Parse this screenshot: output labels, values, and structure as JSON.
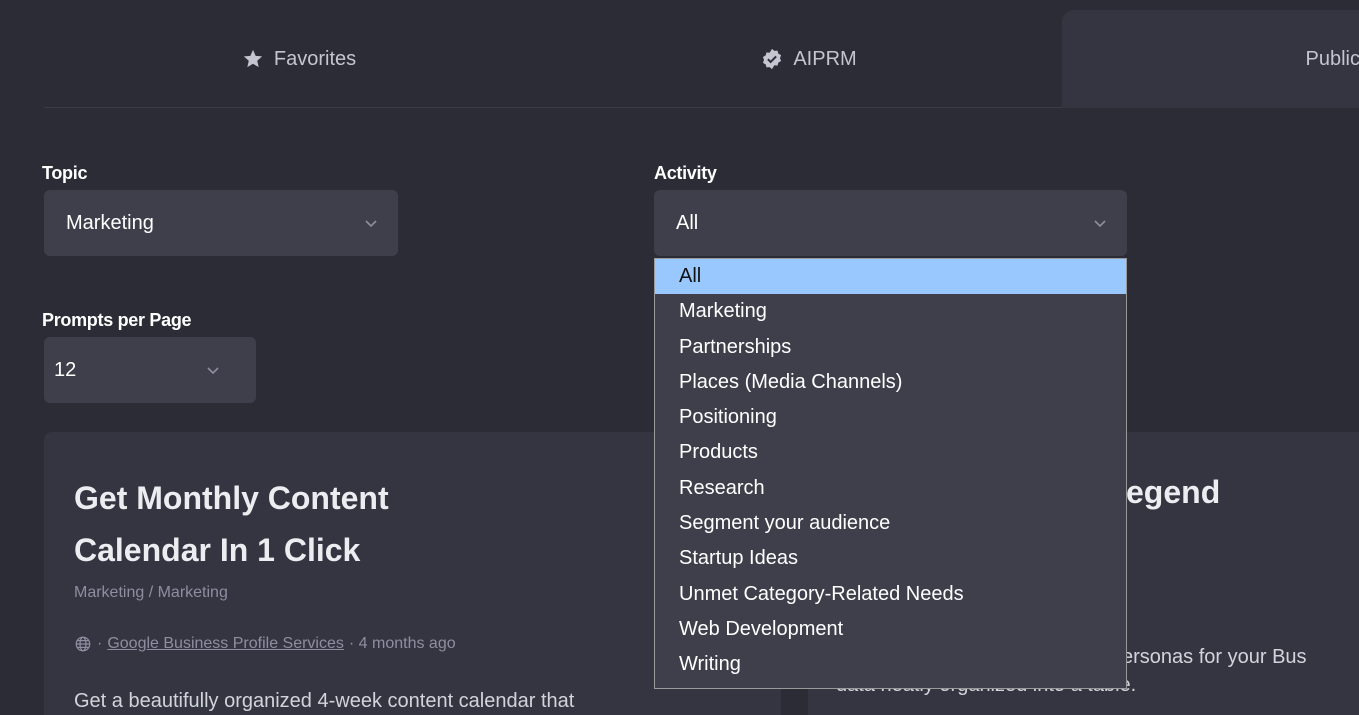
{
  "tabs": [
    {
      "label": "Favorites",
      "icon": "star-icon"
    },
    {
      "label": "AIPRM",
      "icon": "verified-icon"
    },
    {
      "label": "Public",
      "icon": ""
    }
  ],
  "filters": {
    "topic": {
      "label": "Topic",
      "value": "Marketing"
    },
    "activity": {
      "label": "Activity",
      "value": "All"
    },
    "per_page": {
      "label": "Prompts per Page",
      "value": "12"
    }
  },
  "activity_options": [
    "All",
    "Marketing",
    "Partnerships",
    "Places (Media Channels)",
    "Positioning",
    "Products",
    "Research",
    "Segment your audience",
    "Startup Ideas",
    "Unmet Category-Related Needs",
    "Web Development",
    "Writing"
  ],
  "activity_selected_index": 0,
  "cards": [
    {
      "title": "Get Monthly Content Calendar In 1 Click",
      "category": "Marketing / Marketing",
      "author": "Google Business Profile Services",
      "age": "· 4 months ago",
      "description": "Get a beautifully organized 4-week content calendar that"
    },
    {
      "title_visible": "egend",
      "desc_line1_visible": "ersonas for your Bus",
      "desc_line2_visible": "data neatly organized into a table."
    }
  ],
  "colors": {
    "background": "#2b2c36",
    "panel": "#343541",
    "control": "#3e3f4b",
    "highlight": "#99c8ff"
  }
}
